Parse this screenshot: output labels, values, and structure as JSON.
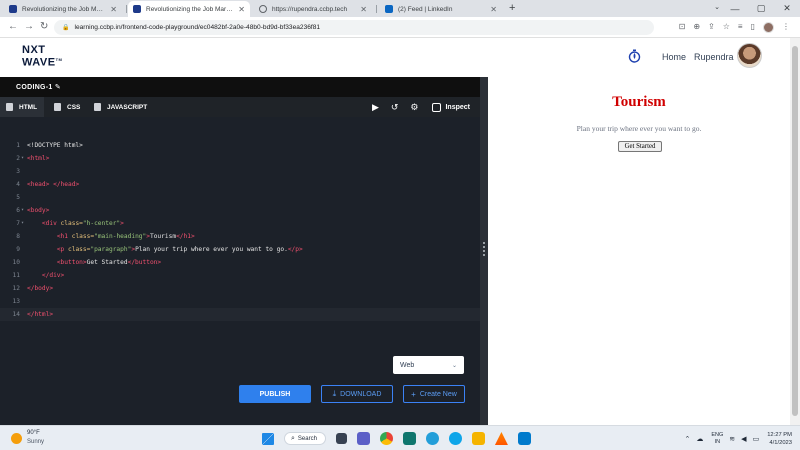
{
  "browser": {
    "tabs": [
      {
        "title": "Revolutionizing the Job Market |",
        "active": false,
        "favicon_color": "#1e3a8a"
      },
      {
        "title": "Revolutionizing the Job Market |",
        "active": true,
        "favicon_color": "#1e3a8a"
      },
      {
        "title": "https://rupendra.ccbp.tech",
        "active": false,
        "favicon_color": "#5f6368"
      },
      {
        "title": "(2) Feed | LinkedIn",
        "active": false,
        "favicon_color": "#0a66c2"
      }
    ],
    "url": "learning.ccbp.in/frontend-code-playground/ec0482bf-2a0e-48b0-bd9d-bf33ea236f81"
  },
  "site": {
    "logo_line1": "NXT",
    "logo_line2": "WAVE",
    "logo_tm": "TM",
    "nav_home": "Home",
    "user_name": "Rupendra"
  },
  "editor": {
    "project_name": "CODING-1",
    "tabs": [
      {
        "label": "HTML",
        "active": true
      },
      {
        "label": "CSS",
        "active": false
      },
      {
        "label": "JAVASCRIPT",
        "active": false
      }
    ],
    "inspect_label": "Inspect",
    "view_select": "Web",
    "publish_label": "PUBLISH",
    "download_label": "DOWNLOAD",
    "create_new_label": "Create New",
    "code_lines": [
      {
        "n": "1",
        "html": "<span class=\"c-txt\">&lt;!DOCTYPE html&gt;</span>"
      },
      {
        "n": "2",
        "fold": true,
        "html": "<span class=\"c-tag\">&lt;html&gt;</span>"
      },
      {
        "n": "3",
        "html": ""
      },
      {
        "n": "4",
        "html": "<span class=\"c-tag\">&lt;head&gt;</span> <span class=\"c-tag\">&lt;/head&gt;</span>"
      },
      {
        "n": "5",
        "html": ""
      },
      {
        "n": "6",
        "fold": true,
        "html": "<span class=\"c-tag\">&lt;body&gt;</span>"
      },
      {
        "n": "7",
        "fold": true,
        "html": "    <span class=\"c-tag\">&lt;div</span> <span class=\"c-attr\">class=</span><span class=\"c-str\">\"h-center\"</span><span class=\"c-tag\">&gt;</span>"
      },
      {
        "n": "8",
        "html": "        <span class=\"c-tag\">&lt;h1</span> <span class=\"c-attr\">class=</span><span class=\"c-str\">\"main-heading\"</span><span class=\"c-tag\">&gt;</span>Tourism<span class=\"c-tag\">&lt;/h1&gt;</span>"
      },
      {
        "n": "9",
        "html": "        <span class=\"c-tag\">&lt;p</span> <span class=\"c-attr\">class=</span><span class=\"c-str\">\"paragraph\"</span><span class=\"c-tag\">&gt;</span>Plan your trip where ever you want to go.<span class=\"c-tag\">&lt;/p&gt;</span>"
      },
      {
        "n": "10",
        "html": "        <span class=\"c-tag\">&lt;button&gt;</span>Get Started<span class=\"c-tag\">&lt;/button&gt;</span>"
      },
      {
        "n": "11",
        "html": "    <span class=\"c-tag\">&lt;/div&gt;</span>"
      },
      {
        "n": "12",
        "html": "<span class=\"c-tag\">&lt;/body&gt;</span>"
      },
      {
        "n": "13",
        "html": ""
      },
      {
        "n": "14",
        "current": true,
        "html": "<span class=\"c-tag\">&lt;/html&gt;</span>"
      }
    ]
  },
  "preview": {
    "heading": "Tourism",
    "paragraph": "Plan your trip where ever you want to go.",
    "button": "Get Started",
    "heading_color": "#d00000"
  },
  "taskbar": {
    "temperature": "90°F",
    "weather": "Sunny",
    "search_label": "Search",
    "lang_line1": "ENG",
    "lang_line2": "IN",
    "time": "12:27 PM",
    "date": "4/1/2023"
  }
}
